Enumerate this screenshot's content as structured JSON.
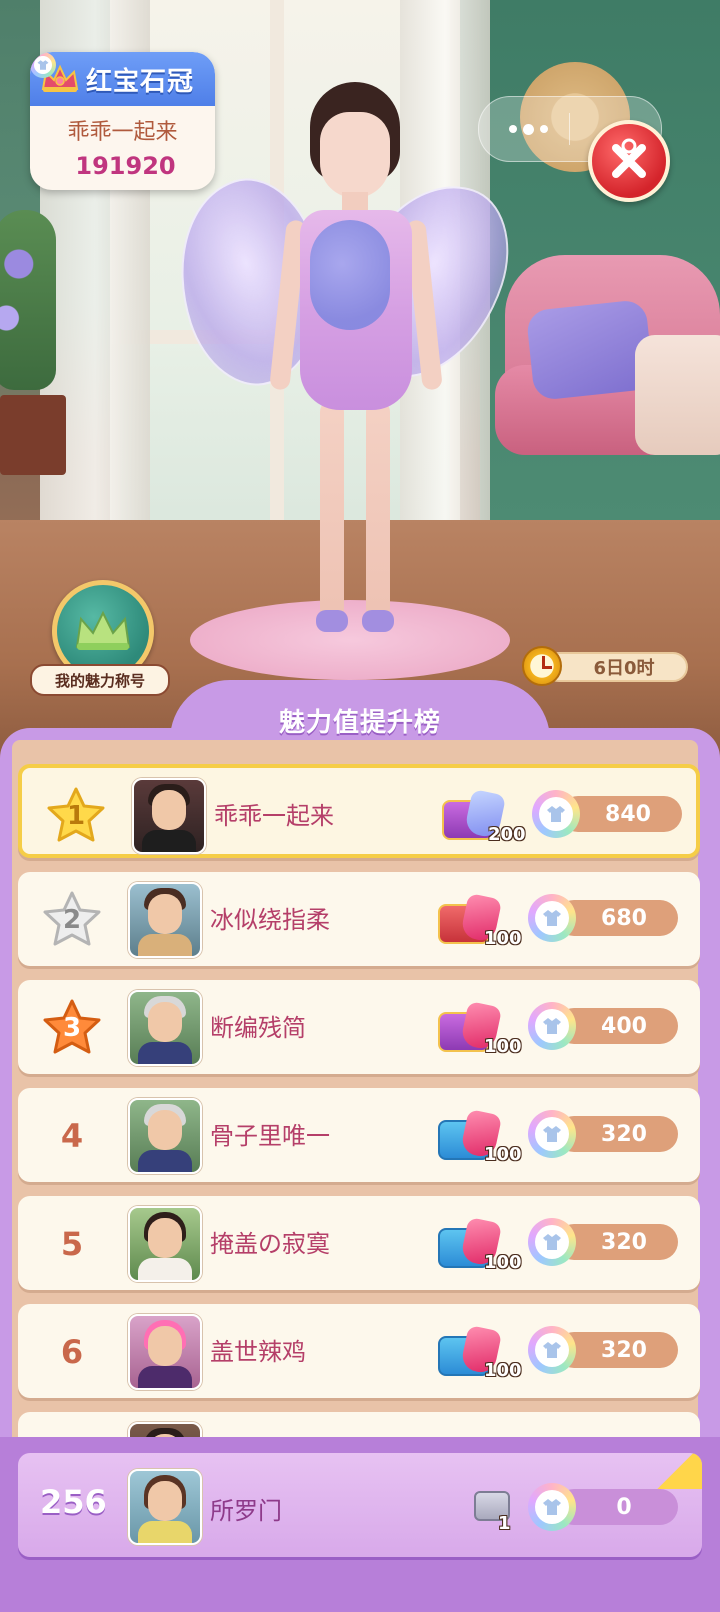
{
  "crown_card": {
    "title": "红宝石冠",
    "user": "乖乖一起来",
    "score": "191920",
    "icon": "ruby-crown-icon"
  },
  "top_controls": {
    "menu_icon": "more-dots-icon",
    "close_icon": "close-icon"
  },
  "charm_title": {
    "label": "我的魅力称号",
    "icon": "green-crown-icon"
  },
  "timer": {
    "text": "6日0时",
    "icon": "alarm-clock-icon"
  },
  "leaderboard": {
    "title": "魅力值提升榜",
    "rows": [
      {
        "rank": "1",
        "name": "乖乖一起来",
        "gift_count": "200",
        "score": "840"
      },
      {
        "rank": "2",
        "name": "冰似绕指柔",
        "gift_count": "100",
        "score": "680"
      },
      {
        "rank": "3",
        "name": "断编残简",
        "gift_count": "100",
        "score": "400"
      },
      {
        "rank": "4",
        "name": "骨子里唯一",
        "gift_count": "100",
        "score": "320"
      },
      {
        "rank": "5",
        "name": "掩盖の寂寞",
        "gift_count": "100",
        "score": "320"
      },
      {
        "rank": "6",
        "name": "盖世辣鸡",
        "gift_count": "100",
        "score": "320"
      }
    ]
  },
  "me": {
    "rank": "256",
    "name": "所罗门",
    "gift_count": "1",
    "score": "0"
  },
  "colors": {
    "name_pink": "#b53f69",
    "panel_purple": "#c89ae6",
    "gold_border": "#f5cd47"
  }
}
